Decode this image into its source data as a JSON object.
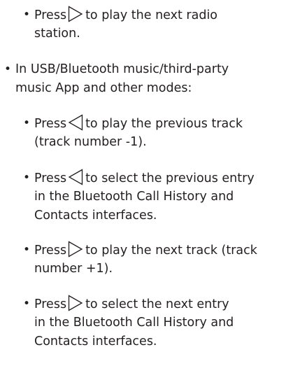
{
  "document": {
    "bullet_glyph": "•",
    "items": [
      {
        "level": 2,
        "before_icon": "Press",
        "icon": "right-triangle-icon",
        "lines": [
          "to play the next radio",
          "station."
        ]
      },
      {
        "level": 1,
        "lines": [
          "In USB/Bluetooth music/third-party",
          "music App and other modes:"
        ]
      },
      {
        "level": 2,
        "before_icon": "Press",
        "icon": "left-triangle-icon",
        "lines": [
          "to play the previous track",
          "(track number -1)."
        ]
      },
      {
        "level": 2,
        "before_icon": "Press",
        "icon": "left-triangle-icon",
        "lines": [
          "to select the previous entry",
          "in the Bluetooth Call History and",
          "Contacts interfaces."
        ]
      },
      {
        "level": 2,
        "before_icon": "Press",
        "icon": "right-triangle-icon",
        "lines": [
          "to play the next track (track",
          "number +1)."
        ]
      },
      {
        "level": 2,
        "before_icon": "Press",
        "icon": "right-triangle-icon",
        "lines": [
          "to select the next entry",
          "in the Bluetooth Call History and",
          "Contacts interfaces."
        ]
      }
    ]
  }
}
